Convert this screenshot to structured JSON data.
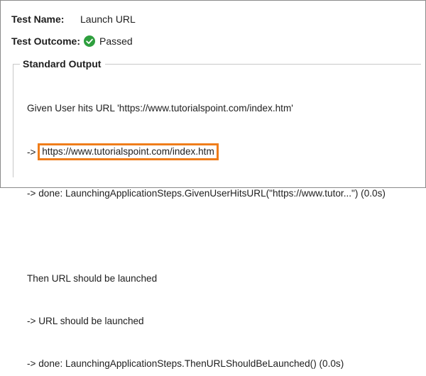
{
  "test_name": {
    "label": "Test Name:",
    "value": "Launch URL"
  },
  "test_outcome": {
    "label": "Test Outcome:",
    "value": "Passed",
    "icon": "check-circle-icon",
    "icon_color": "#2e9f3e"
  },
  "standard_output": {
    "title": "Standard Output",
    "lines": [
      "Given User hits URL 'https://www.tutorialspoint.com/index.htm'",
      "https://www.tutorialspoint.com/index.htm",
      "-> done: LaunchingApplicationSteps.GivenUserHitsURL(\"https://www.tutor...\") (0.0s)",
      "Then URL should be launched",
      "-> URL should be launched",
      "-> done: LaunchingApplicationSteps.ThenURLShouldBeLaunched() (0.0s)"
    ],
    "arrow_prefix": "-> ",
    "highlight_color": "#ef7d1a"
  }
}
